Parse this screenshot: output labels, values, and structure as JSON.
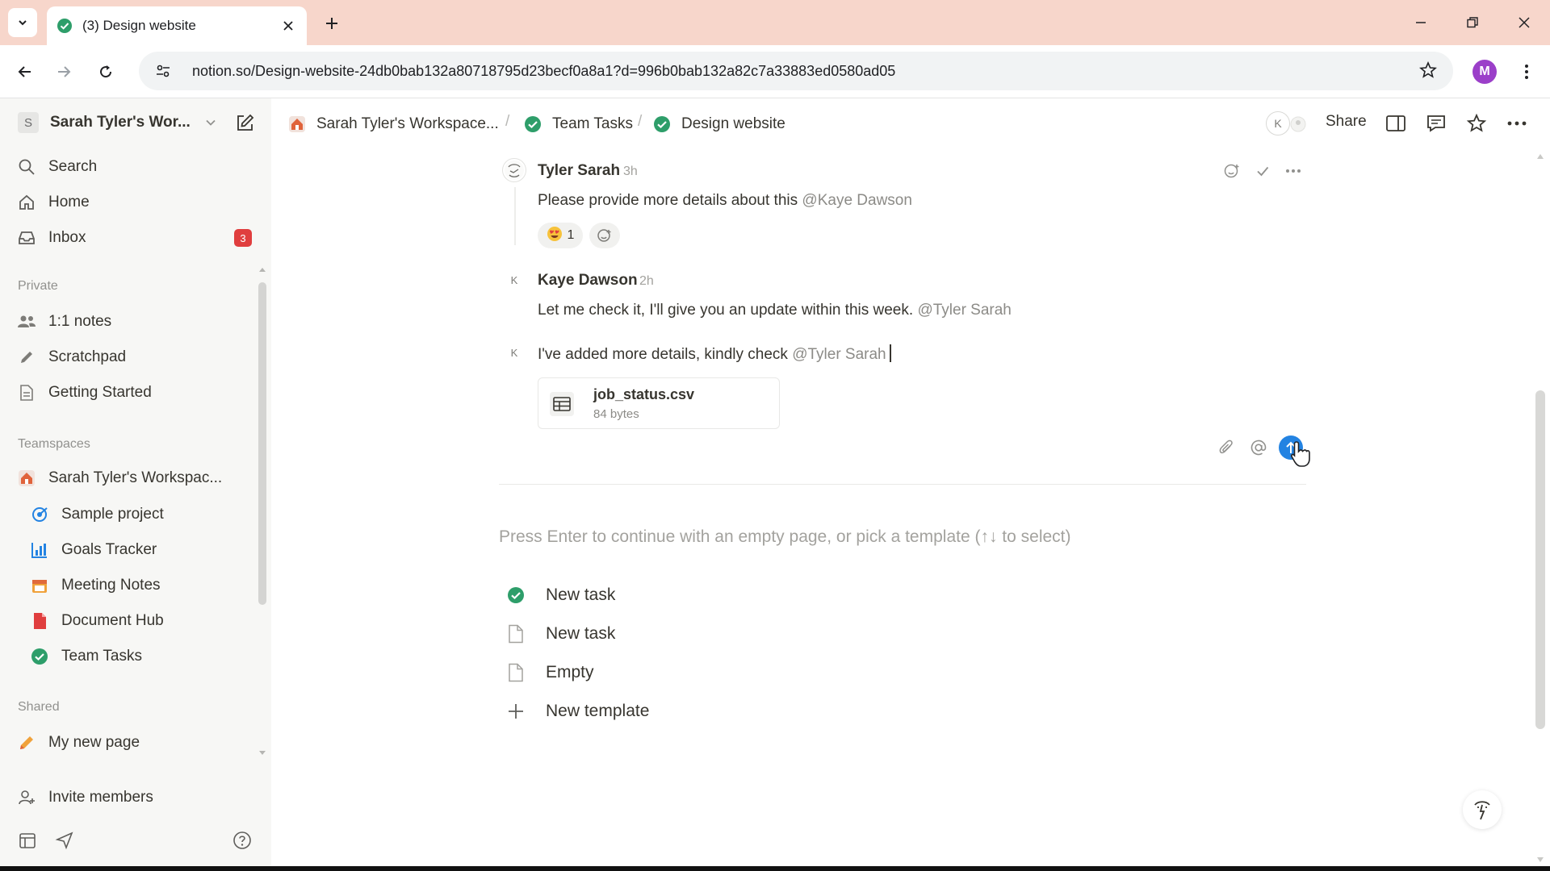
{
  "browser": {
    "tab_title": "(3) Design website",
    "url": "notion.so/Design-website-24db0bab132a80718795d23becf0a8a1?d=996b0bab132a82c7a33883ed0580ad05",
    "profile_initial": "M"
  },
  "sidebar": {
    "workspace_initial": "S",
    "workspace_name": "Sarah Tyler's Wor...",
    "nav": [
      {
        "label": "Search",
        "icon": "search-icon"
      },
      {
        "label": "Home",
        "icon": "home-icon"
      },
      {
        "label": "Inbox",
        "icon": "inbox-icon",
        "badge": "3"
      }
    ],
    "private_label": "Private",
    "private_items": [
      {
        "label": "1:1 notes",
        "icon": "people-icon"
      },
      {
        "label": "Scratchpad",
        "icon": "pencil-icon"
      },
      {
        "label": "Getting Started",
        "icon": "page-icon"
      }
    ],
    "teamspaces_label": "Teamspaces",
    "teamspace_name": "Sarah Tyler's Workspac...",
    "teamspace_items": [
      {
        "label": "Sample project",
        "icon": "target-icon"
      },
      {
        "label": "Goals Tracker",
        "icon": "chart-icon"
      },
      {
        "label": "Meeting Notes",
        "icon": "calendar-icon"
      },
      {
        "label": "Document Hub",
        "icon": "document-icon"
      },
      {
        "label": "Team Tasks",
        "icon": "check-circle-icon"
      }
    ],
    "shared_label": "Shared",
    "shared_items": [
      {
        "label": "My new page",
        "icon": "pencil-icon"
      }
    ],
    "invite_label": "Invite members"
  },
  "topbar": {
    "breadcrumbs": [
      "Sarah Tyler's Workspace...",
      "Team Tasks",
      "Design website"
    ],
    "avatar_initial": "K",
    "share_label": "Share"
  },
  "comments": [
    {
      "author": "Tyler Sarah",
      "time": "3h",
      "text": "Please provide more details about this",
      "mention": "@Kaye Dawson",
      "reaction_count": "1"
    },
    {
      "author": "Kaye Dawson",
      "avatar_initial": "K",
      "time": "2h",
      "text": "Let me check it, I'll give you an update within this week.",
      "mention": "@Tyler Sarah"
    }
  ],
  "composer": {
    "avatar_initial": "K",
    "text": "I've added more details, kindly check",
    "mention": "@Tyler Sarah",
    "attachment": {
      "name": "job_status.csv",
      "size": "84 bytes"
    }
  },
  "page": {
    "placeholder": "Press Enter to continue with an empty page, or pick a template (↑↓ to select)",
    "templates": [
      {
        "label": "New task",
        "icon": "check-circle-icon"
      },
      {
        "label": "New task",
        "icon": "page-icon"
      },
      {
        "label": "Empty",
        "icon": "page-icon"
      },
      {
        "label": "New template",
        "icon": "plus-icon"
      }
    ]
  },
  "colors": {
    "accent": "#2383e2",
    "green": "#2e9e6a",
    "badge_red": "#e03e3e",
    "tab_bar": "#f7d6cb"
  }
}
